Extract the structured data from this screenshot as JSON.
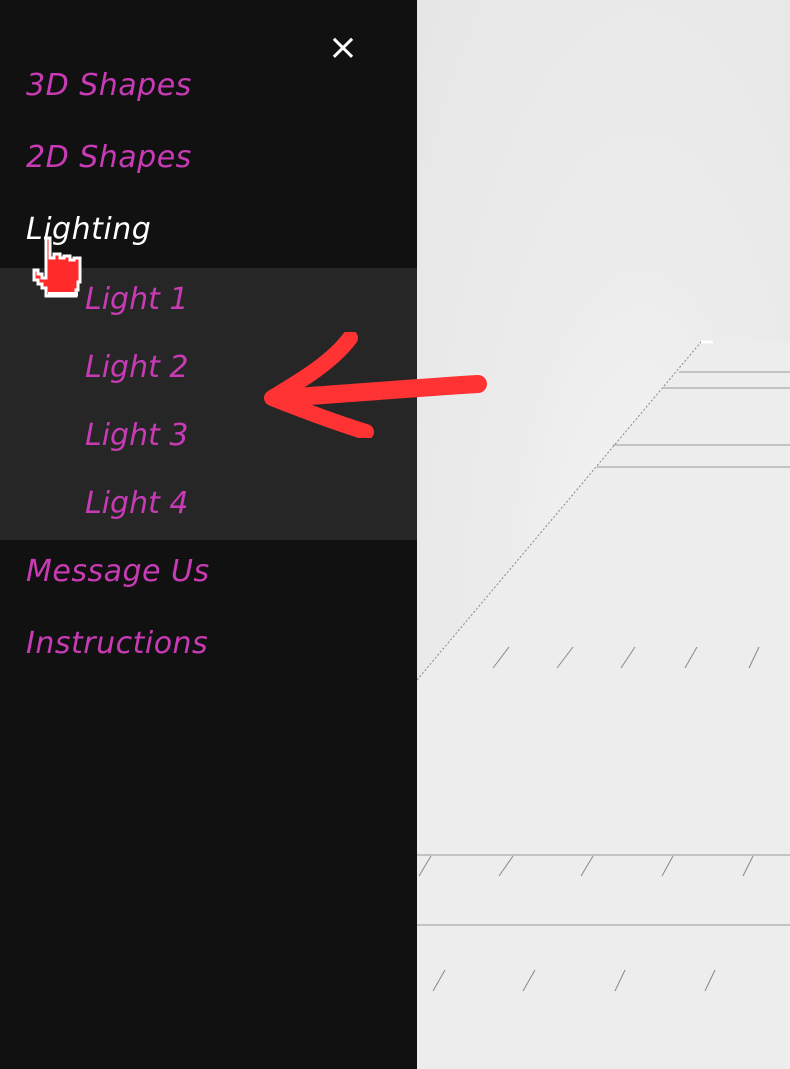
{
  "sidenav": {
    "close_glyph": "×",
    "items": [
      {
        "label": "3D Shapes"
      },
      {
        "label": "2D Shapes"
      },
      {
        "label": "Lighting"
      },
      {
        "label": "Message Us"
      },
      {
        "label": "Instructions"
      }
    ],
    "submenu": [
      {
        "label": "Light 1"
      },
      {
        "label": "Light 2"
      },
      {
        "label": "Light 3"
      },
      {
        "label": "Light 4"
      }
    ]
  },
  "colors": {
    "nav_background": "#111111",
    "submenu_background": "#262626",
    "link": "#c93bb5",
    "active_link": "#ffffff",
    "annotation_arrow": "#ff3333"
  },
  "icons": {
    "close": "close-icon",
    "cursor": "hand-pointer-icon",
    "annotation": "red-arrow-icon"
  }
}
